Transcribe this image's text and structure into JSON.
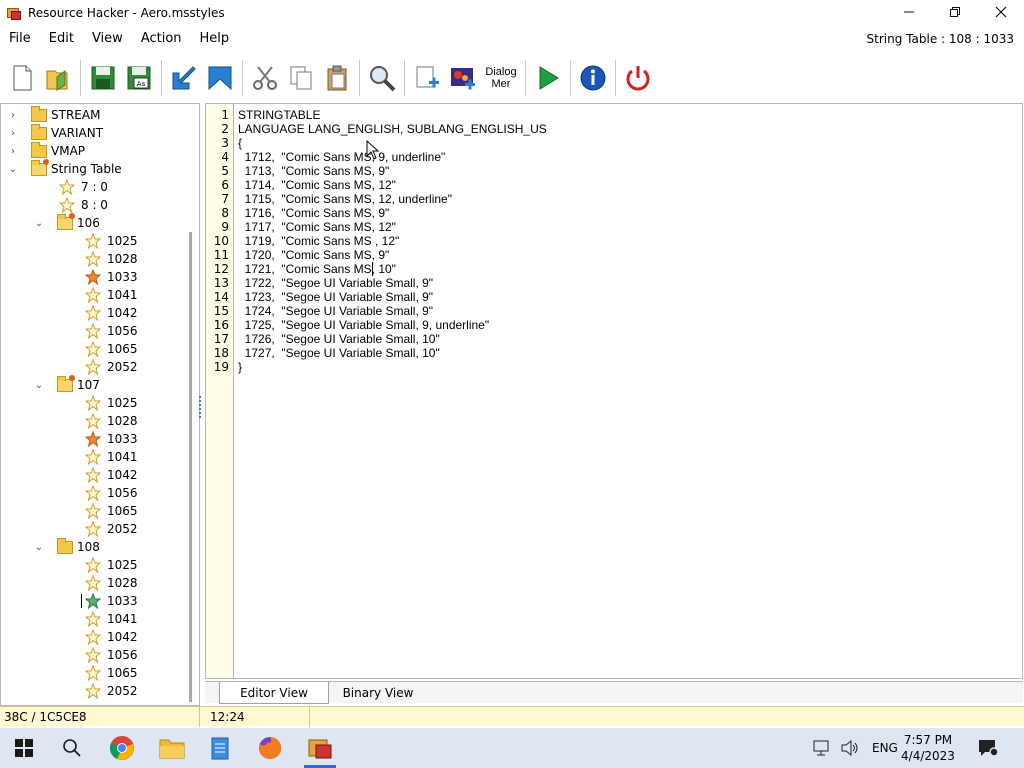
{
  "window": {
    "title": "Resource Hacker - Aero.msstyles"
  },
  "menu": [
    "File",
    "Edit",
    "View",
    "Action",
    "Help"
  ],
  "resource_label": "String Table : 108 : 1033",
  "toolbar": {
    "dialog_label_1": "Dialog",
    "dialog_label_2": "Mer"
  },
  "tree": {
    "top_items": [
      "STREAM",
      "VARIANT",
      "VMAP",
      "String Table"
    ],
    "string_entries": [
      "7 : 0",
      "8 : 0"
    ],
    "groups": [
      {
        "name": "106",
        "langs": [
          "1025",
          "1028",
          "1033",
          "1041",
          "1042",
          "1056",
          "1065",
          "2052"
        ]
      },
      {
        "name": "107",
        "langs": [
          "1025",
          "1028",
          "1033",
          "1041",
          "1042",
          "1056",
          "1065",
          "2052"
        ]
      },
      {
        "name": "108",
        "langs": [
          "1025",
          "1028",
          "1033",
          "1041",
          "1042",
          "1056",
          "1065",
          "2052"
        ]
      }
    ]
  },
  "editor": {
    "line_numbers": [
      "1",
      "2",
      "3",
      "4",
      "5",
      "6",
      "7",
      "8",
      "9",
      "10",
      "11",
      "12",
      "13",
      "14",
      "15",
      "16",
      "17",
      "18",
      "19"
    ],
    "lines": [
      "STRINGTABLE",
      "LANGUAGE LANG_ENGLISH, SUBLANG_ENGLISH_US",
      "{",
      "  1712,  \"Comic Sans MS, 9, underline\"",
      "  1713,  \"Comic Sans MS, 9\"",
      "  1714,  \"Comic Sans MS, 12\"",
      "  1715,  \"Comic Sans MS, 12, underline\"",
      "  1716,  \"Comic Sans MS, 9\"",
      "  1717,  \"Comic Sans MS, 12\"",
      "  1719,  \"Comic Sans MS , 12\"",
      "  1720,  \"Comic Sans MS, 9\"",
      "  1721,  \"Comic Sans MS, 10\"",
      "  1722,  \"Segoe UI Variable Small, 9\"",
      "  1723,  \"Segoe UI Variable Small, 9\"",
      "  1724,  \"Segoe UI Variable Small, 9\"",
      "  1725,  \"Segoe UI Variable Small, 9, underline\"",
      "  1726,  \"Segoe UI Variable Small, 10\"",
      "  1727,  \"Segoe UI Variable Small, 10\"",
      "}"
    ]
  },
  "tabs": [
    "Editor View",
    "Binary View"
  ],
  "status": {
    "offset": "38C / 1C5CE8",
    "position": "12:24"
  },
  "taskbar": {
    "lang": "ENG",
    "time": "7:57 PM",
    "date": "4/4/2023"
  }
}
